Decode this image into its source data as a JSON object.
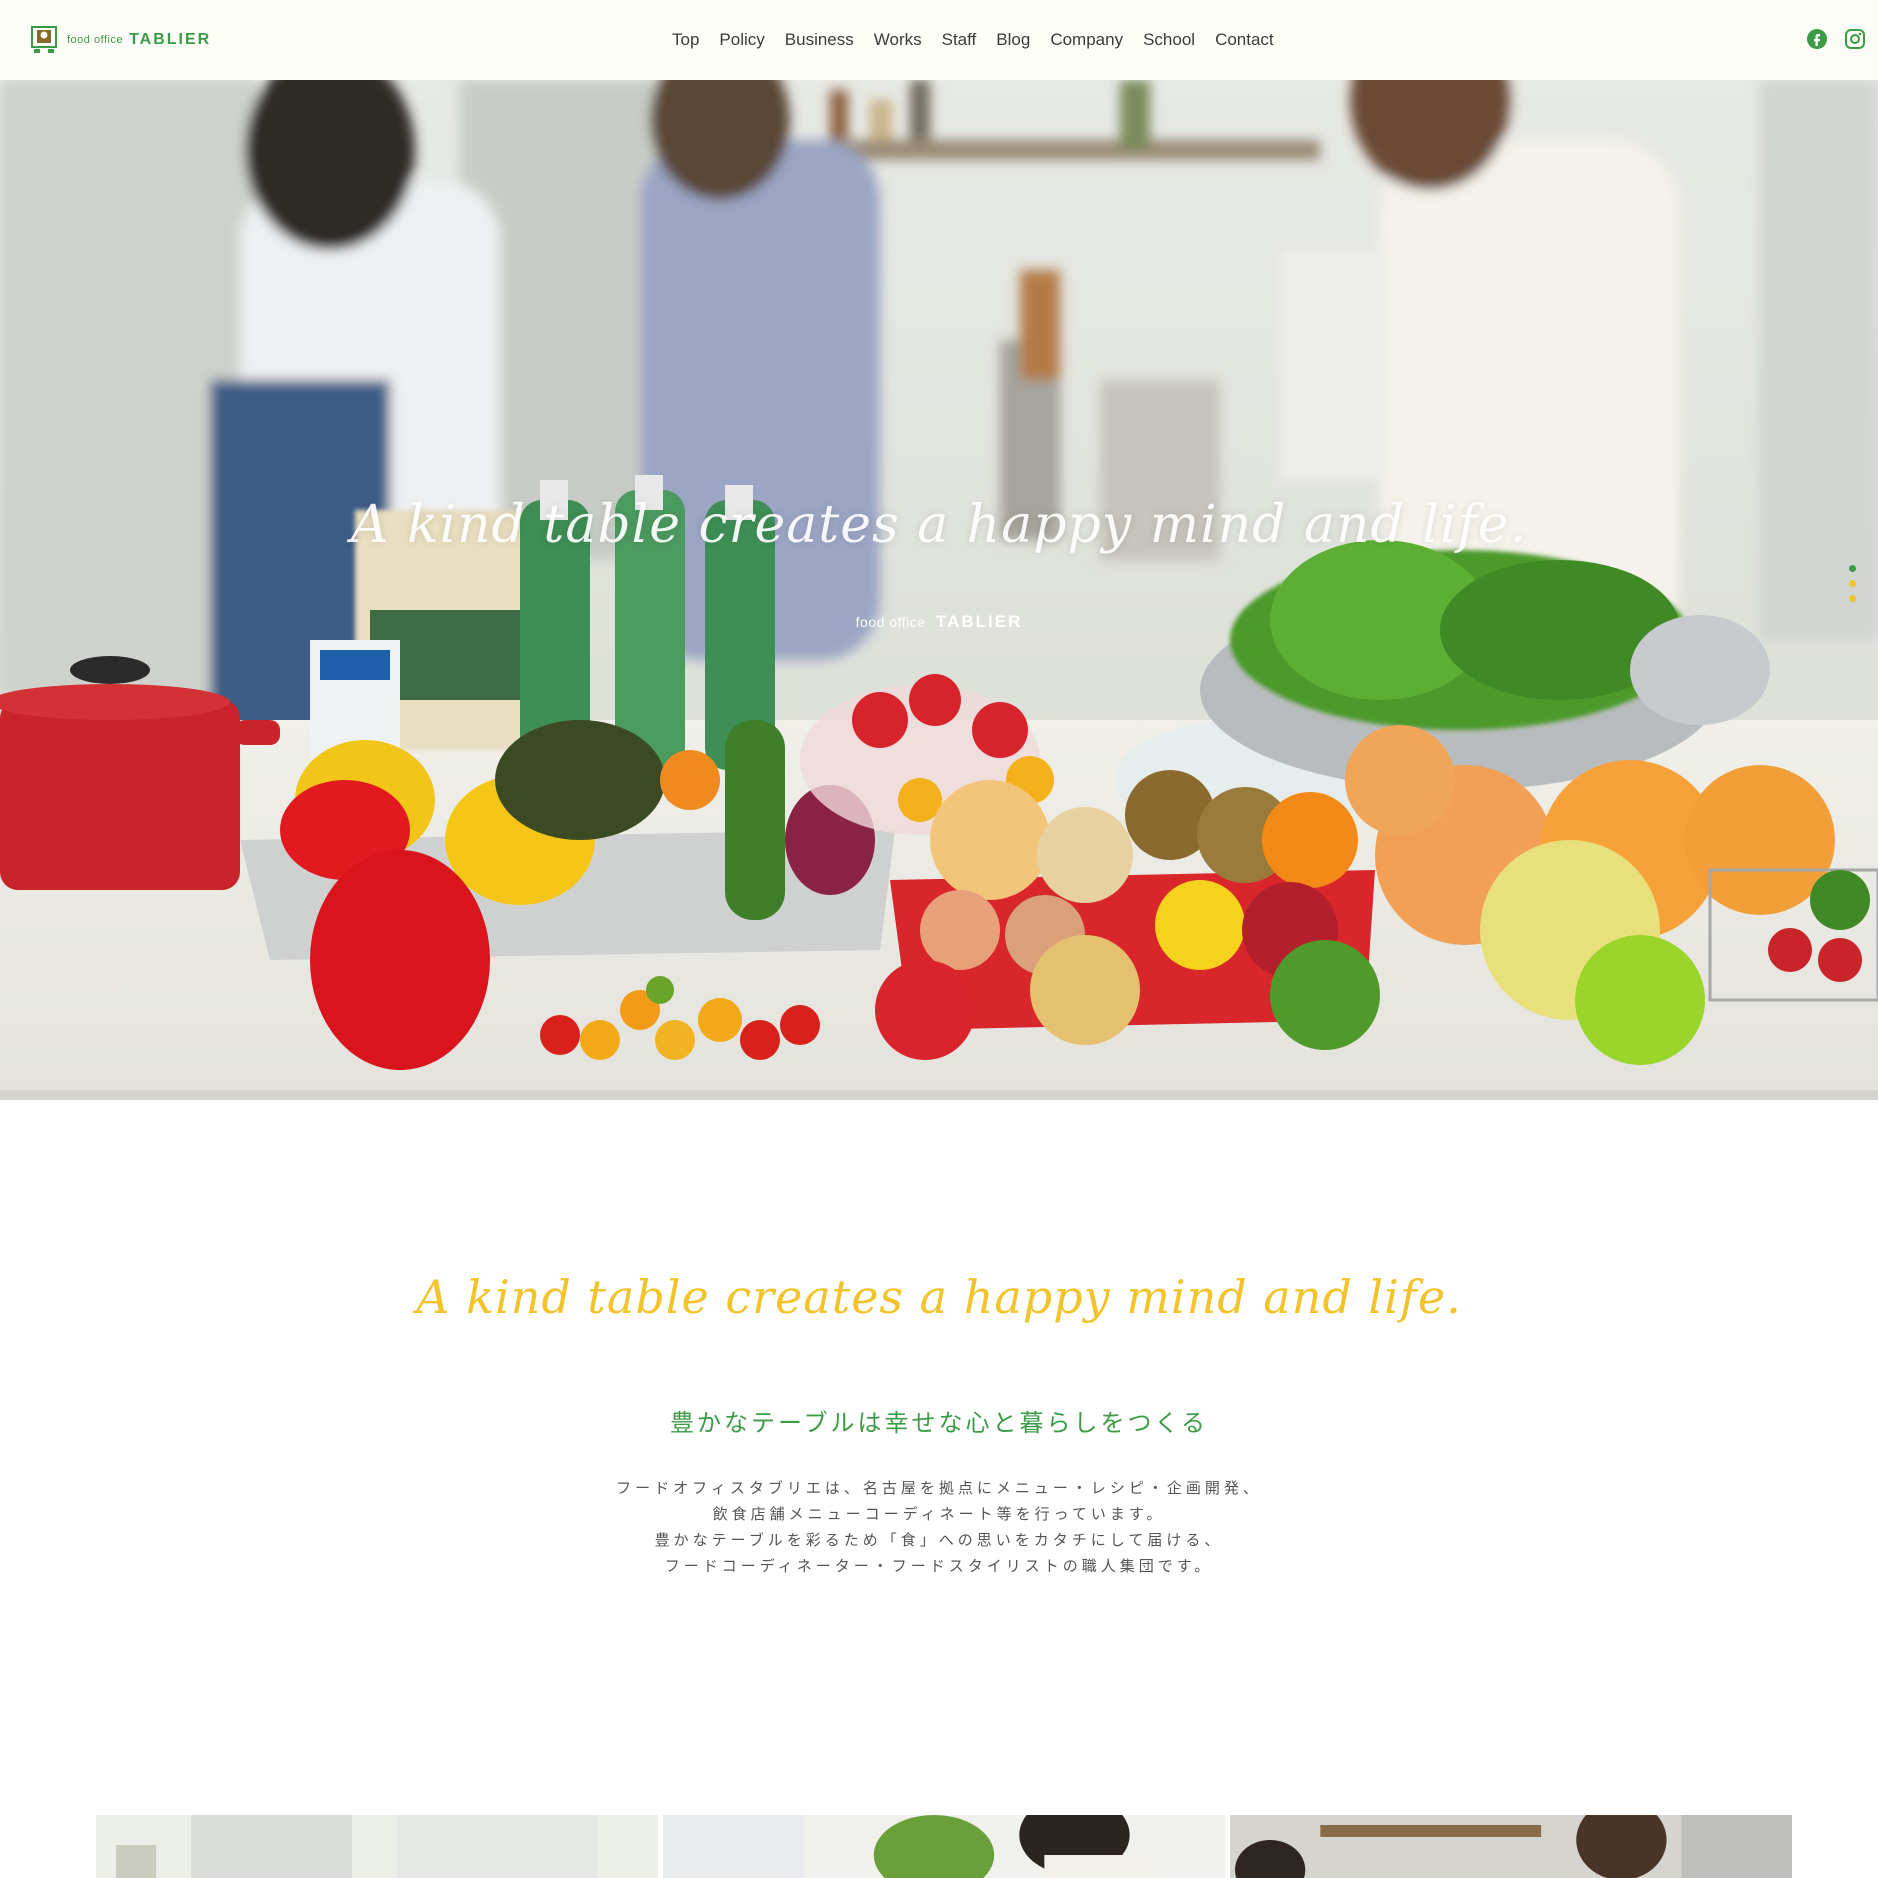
{
  "brand": {
    "sub": "food office",
    "main": "TABLIER",
    "accent_color": "#3c9b46"
  },
  "nav": {
    "items": [
      "Top",
      "Policy",
      "Business",
      "Works",
      "Staff",
      "Blog",
      "Company",
      "School",
      "Contact"
    ]
  },
  "social": {
    "icons": [
      "facebook-icon",
      "instagram-icon"
    ]
  },
  "hero": {
    "tagline": "A kind table creates a happy mind and life.",
    "logo_sub": "food office",
    "logo_main": "TABLIER",
    "slide_dots": 3,
    "slide_dot_colors": [
      "#3c9b46",
      "#f2c32a",
      "#f2c32a"
    ]
  },
  "intro": {
    "tagline": "A kind table creates a happy mind and life.",
    "tagline_color": "#f2c32a",
    "heading_jp": "豊かなテーブルは幸せな心と暮らしをつくる",
    "body": [
      "フードオフィスタブリエは、名古屋を拠点にメニュー・レシピ・企画開発、",
      "飲食店舗メニューコーディネート等を行っています。",
      "豊かなテーブルを彩るため「食」への思いをカタチにして届ける、",
      "フードコーディネーター・フードスタイリストの職人集団です。"
    ]
  }
}
